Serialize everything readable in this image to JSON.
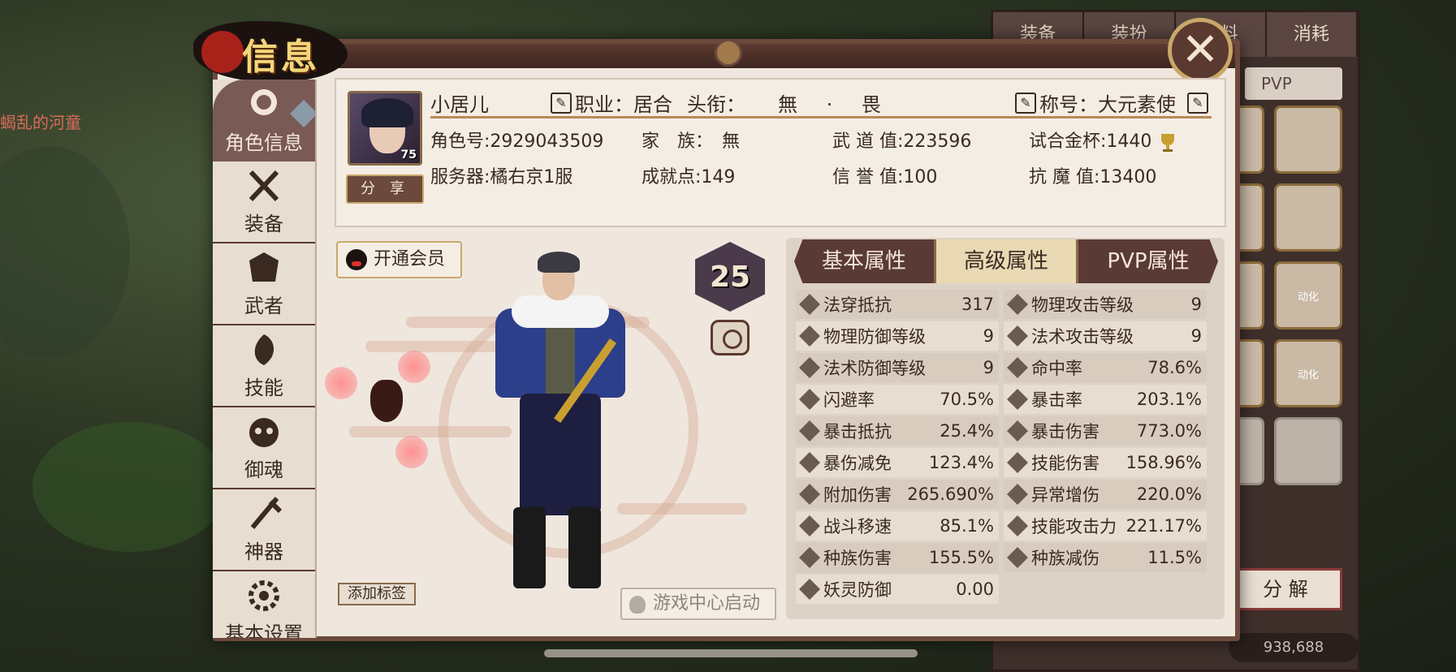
{
  "background": {
    "left_text": "蝎乱的河童"
  },
  "back_panel": {
    "tabs": [
      "装备",
      "装扮",
      "资料",
      "消耗"
    ],
    "pvp_label": "PVP",
    "cell_labels": [
      "动化",
      "动化"
    ],
    "decompose_label": "分 解",
    "currency": "938,688"
  },
  "window": {
    "title": "信息",
    "close_icon": "close-icon"
  },
  "sidebar": {
    "items": [
      {
        "label": "角色信息",
        "icon": "character-icon"
      },
      {
        "label": "装备",
        "icon": "equipment-icon"
      },
      {
        "label": "武者",
        "icon": "warrior-icon"
      },
      {
        "label": "技能",
        "icon": "skill-icon"
      },
      {
        "label": "御魂",
        "icon": "soul-icon"
      },
      {
        "label": "神器",
        "icon": "artifact-icon"
      },
      {
        "label": "基本设置",
        "icon": "settings-icon"
      }
    ]
  },
  "profile": {
    "avatar_level": "75",
    "share_label": "分 享",
    "name": "小居儿",
    "job_label": "职业：",
    "job_value": "居合",
    "title_label": "头衔：",
    "title_value": "無 · 畏",
    "honor_label": "称号：",
    "honor_value": "大元素使",
    "role_id": "角色号:2929043509",
    "family": "家　族：　無",
    "wudao": "武 道 值:223596",
    "cup": "试合金杯:1440",
    "server": "服务器:橘右京1服",
    "achievement": "成就点:149",
    "credit": "信 誉 值:100",
    "anti_demon": "抗 魔 值:13400"
  },
  "character": {
    "vip_label": "开通会员",
    "level": "25",
    "tag_label": "添加标签",
    "game_center_label": "游戏中心启动"
  },
  "attributes": {
    "tabs": [
      "基本属性",
      "高级属性",
      "PVP属性"
    ],
    "active_tab": 1,
    "rows": [
      {
        "name": "法穿抵抗",
        "value": "317"
      },
      {
        "name": "物理攻击等级",
        "value": "9"
      },
      {
        "name": "物理防御等级",
        "value": "9"
      },
      {
        "name": "法术攻击等级",
        "value": "9"
      },
      {
        "name": "法术防御等级",
        "value": "9"
      },
      {
        "name": "命中率",
        "value": "78.6%"
      },
      {
        "name": "闪避率",
        "value": "70.5%"
      },
      {
        "name": "暴击率",
        "value": "203.1%"
      },
      {
        "name": "暴击抵抗",
        "value": "25.4%"
      },
      {
        "name": "暴击伤害",
        "value": "773.0%"
      },
      {
        "name": "暴伤减免",
        "value": "123.4%"
      },
      {
        "name": "技能伤害",
        "value": "158.96%"
      },
      {
        "name": "附加伤害",
        "value": "265.690%"
      },
      {
        "name": "异常增伤",
        "value": "220.0%"
      },
      {
        "name": "战斗移速",
        "value": "85.1%"
      },
      {
        "name": "技能攻击力",
        "value": "221.17%"
      },
      {
        "name": "种族伤害",
        "value": "155.5%"
      },
      {
        "name": "种族减伤",
        "value": "11.5%"
      },
      {
        "name": "妖灵防御",
        "value": "0.00"
      }
    ]
  }
}
